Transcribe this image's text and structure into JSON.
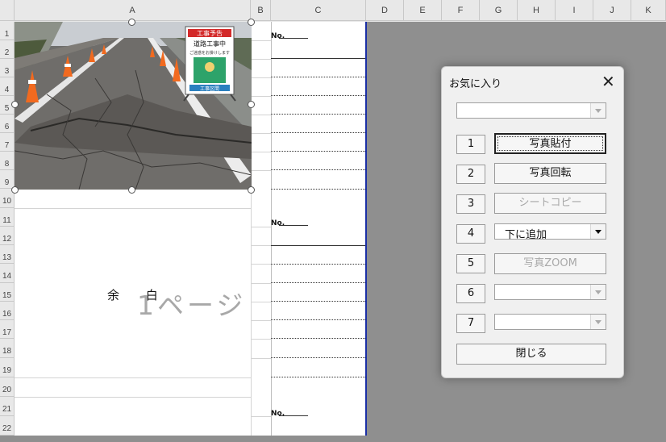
{
  "columns": [
    "A",
    "B",
    "C",
    "D",
    "E",
    "F",
    "G",
    "H",
    "I",
    "J",
    "K"
  ],
  "rows": [
    "1",
    "2",
    "3",
    "4",
    "5",
    "6",
    "7",
    "8",
    "9",
    "10",
    "11",
    "12",
    "13",
    "14",
    "15",
    "16",
    "17",
    "18",
    "19",
    "20",
    "21",
    "22"
  ],
  "sheet": {
    "no_label": "No.",
    "margin_text": "余 白",
    "page_label": "1ページ"
  },
  "dialog": {
    "title": "お気に入り",
    "close": "✕",
    "top_combo_value": "",
    "buttons": [
      {
        "num": "1",
        "label": "写真貼付"
      },
      {
        "num": "2",
        "label": "写真回転"
      },
      {
        "num": "3",
        "label": "シートコピー"
      },
      {
        "num": "4",
        "label": "下に追加"
      },
      {
        "num": "5",
        "label": "写真ZOOM"
      },
      {
        "num": "6",
        "label": ""
      },
      {
        "num": "7",
        "label": ""
      }
    ],
    "close_button": "閉じる"
  },
  "photo": {
    "sign_top": "工事予告",
    "sign_mid": "道路工事中",
    "sign_small": "ご迷惑をお掛けします",
    "sign_bottom": "工事区間"
  }
}
